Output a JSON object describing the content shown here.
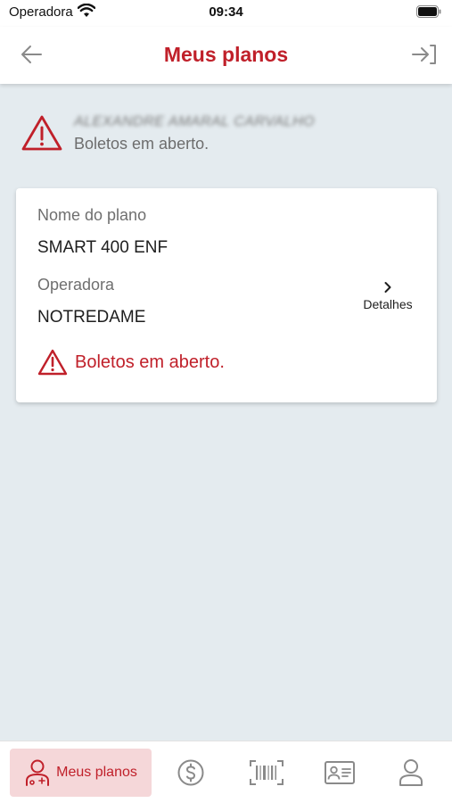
{
  "status_bar": {
    "carrier": "Operadora",
    "time": "09:34"
  },
  "header": {
    "title": "Meus planos",
    "back_icon": "arrow-left-icon",
    "logout_icon": "logout-icon"
  },
  "alert": {
    "user_name": "ALEXANDRE AMARAL CARVALHO",
    "message": "Boletos em aberto."
  },
  "plan_card": {
    "plan_label": "Nome do plano",
    "plan_value": "SMART 400 ENF",
    "operator_label": "Operadora",
    "operator_value": "NOTREDAME",
    "details_label": "Detalhes",
    "alert_text": "Boletos em aberto."
  },
  "bottom_nav": {
    "items": [
      {
        "label": "Meus planos",
        "icon": "user-plans-icon",
        "active": true
      },
      {
        "label": "",
        "icon": "dollar-icon",
        "active": false
      },
      {
        "label": "",
        "icon": "barcode-icon",
        "active": false
      },
      {
        "label": "",
        "icon": "id-card-icon",
        "active": false
      },
      {
        "label": "",
        "icon": "profile-icon",
        "active": false
      }
    ]
  },
  "colors": {
    "accent": "#c0202a",
    "background": "#e4ebef",
    "active_nav_bg": "#f5d7d9"
  }
}
